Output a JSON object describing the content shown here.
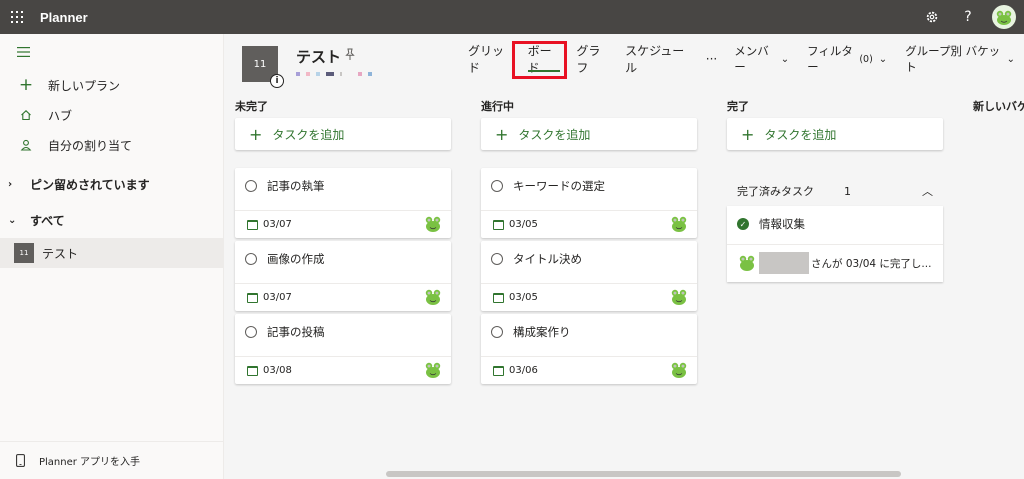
{
  "app": {
    "title": "Planner"
  },
  "topbar": {
    "settings_icon": "gear-icon",
    "help_label": "?",
    "user_avatar_icon": "frog-avatar-icon"
  },
  "sidebar": {
    "items": [
      {
        "label": "新しいプラン",
        "icon": "plus-icon"
      },
      {
        "label": "ハブ",
        "icon": "home-icon"
      },
      {
        "label": "自分の割り当て",
        "icon": "person-icon"
      }
    ],
    "pinned_section": "ピン留めされています",
    "all_section": "すべて",
    "plans": [
      {
        "thumb": "11",
        "name": "テスト"
      }
    ],
    "bottom_link": "Planner アプリを入手"
  },
  "plan": {
    "thumb": "11",
    "name": "テスト",
    "info_label": "i"
  },
  "tabs": [
    {
      "label": "グリッド"
    },
    {
      "label": "ボード"
    },
    {
      "label": "グラフ"
    },
    {
      "label": "スケジュール"
    },
    {
      "label": "···"
    }
  ],
  "active_tab": "ボード",
  "filters": {
    "members": "メンバー",
    "filter": "フィルター",
    "filter_count": "(0)",
    "group_by": "グループ別 バケット"
  },
  "board": {
    "add_task_label": "タスクを追加",
    "columns": [
      {
        "title": "未完了",
        "tasks": [
          {
            "title": "記事の執筆",
            "date": "03/07"
          },
          {
            "title": "画像の作成",
            "date": "03/07"
          },
          {
            "title": "記事の投稿",
            "date": "03/08"
          }
        ]
      },
      {
        "title": "進行中",
        "tasks": [
          {
            "title": "キーワードの選定",
            "date": "03/05"
          },
          {
            "title": "タイトル決め",
            "date": "03/05"
          },
          {
            "title": "構成案作り",
            "date": "03/06"
          }
        ]
      },
      {
        "title": "完了",
        "completed_label": "完了済みタスク",
        "completed_count": "1",
        "completed_task": {
          "title": "情報収集",
          "note": "さんが 03/04 に完了し..."
        }
      }
    ],
    "new_bucket_label": "新しいバケ"
  },
  "colors": {
    "topbar": "#484644",
    "accent": "#31752f",
    "highlight": "#e81123"
  }
}
